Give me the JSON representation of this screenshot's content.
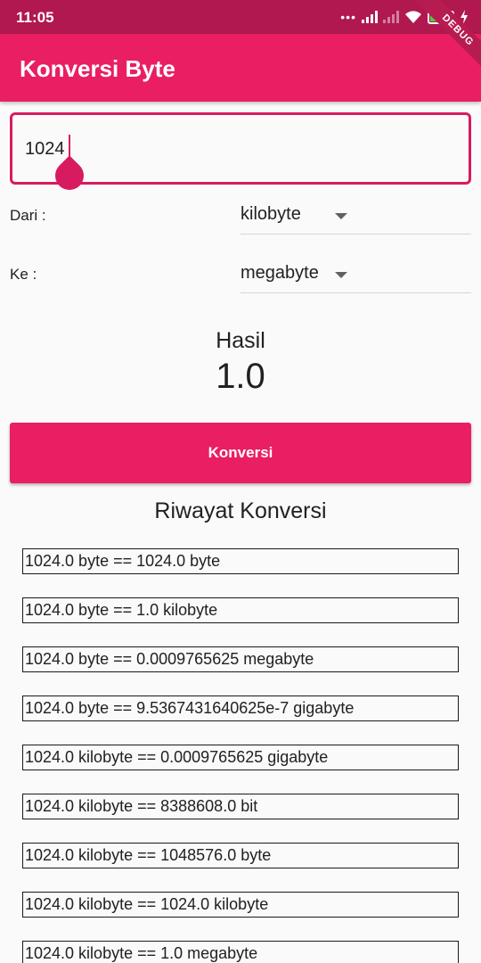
{
  "status_bar": {
    "time": "11:05",
    "battery_level": "93",
    "icons": [
      "dots-icon",
      "signal-icon",
      "signal-icon",
      "wifi-icon",
      "battery-icon",
      "charging-icon"
    ]
  },
  "app_bar": {
    "title": "Konversi Byte"
  },
  "debug_banner": "DEBUG",
  "colors": {
    "primary": "#e91e63",
    "primary_dark": "#b0184f",
    "accent": "#d81b60"
  },
  "input": {
    "value": "1024"
  },
  "from": {
    "label": "Dari :",
    "selected": "kilobyte"
  },
  "to": {
    "label": "Ke :",
    "selected": "megabyte"
  },
  "result": {
    "label": "Hasil",
    "value": "1.0"
  },
  "convert_button": {
    "label": "Konversi"
  },
  "history": {
    "title": "Riwayat Konversi",
    "items": [
      "1024.0 byte == 1024.0 byte",
      "1024.0 byte == 1.0 kilobyte",
      "1024.0 byte == 0.0009765625 megabyte",
      "1024.0 byte == 9.5367431640625e-7 gigabyte",
      "1024.0 kilobyte == 0.0009765625 gigabyte",
      "1024.0 kilobyte == 8388608.0 bit",
      "1024.0 kilobyte == 1048576.0 byte",
      "1024.0 kilobyte == 1024.0 kilobyte",
      "1024.0 kilobyte == 1.0 megabyte"
    ]
  }
}
